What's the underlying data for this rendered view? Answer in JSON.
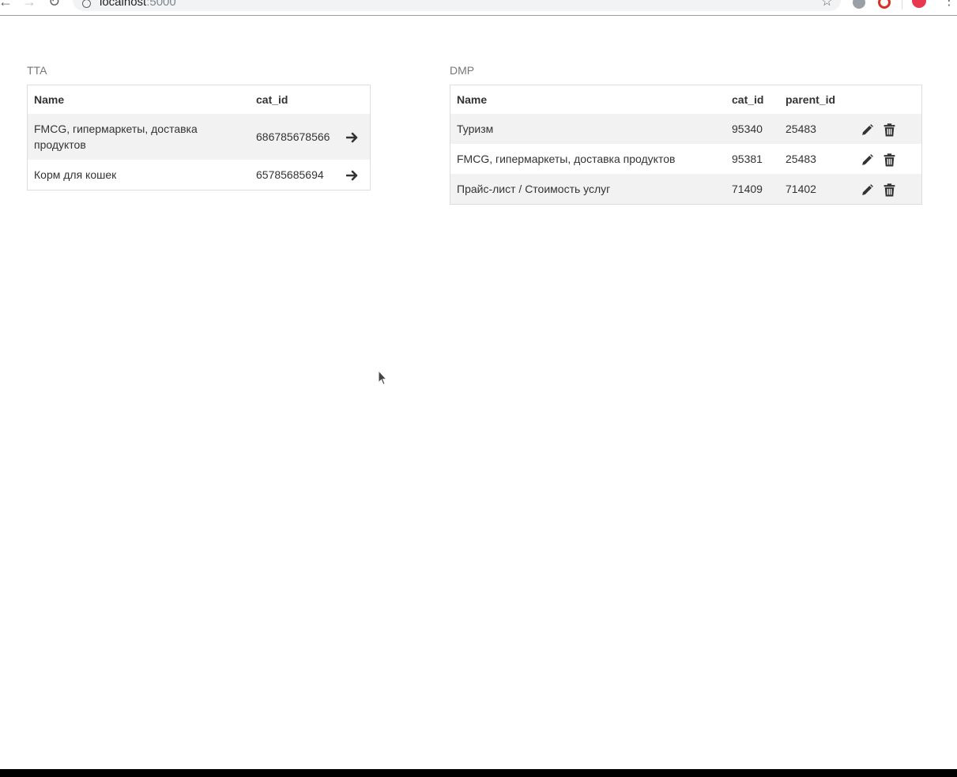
{
  "browser": {
    "url_host": "localhost",
    "url_port": ":5000"
  },
  "tta": {
    "heading": "TTA",
    "columns": [
      "Name",
      "cat_id"
    ],
    "rows": [
      {
        "name": "FMCG, гипермаркеты, доставка продуктов",
        "cat_id": "686785678566"
      },
      {
        "name": "Корм для кошек",
        "cat_id": "65785685694"
      }
    ],
    "row_action_icon": "arrow-right-icon"
  },
  "dmp": {
    "heading": "DMP",
    "columns": [
      "Name",
      "cat_id",
      "parent_id"
    ],
    "rows": [
      {
        "name": "Туризм",
        "cat_id": "95340",
        "parent_id": "25483"
      },
      {
        "name": "FMCG, гипермаркеты, доставка продуктов",
        "cat_id": "95381",
        "parent_id": "25483"
      },
      {
        "name": "Прайс-лист / Стоимость услуг",
        "cat_id": "71409",
        "parent_id": "71402"
      }
    ],
    "row_action_icons": [
      "pencil-icon",
      "trash-icon"
    ]
  },
  "colors": {
    "stripe": "#f2f2f2",
    "border": "#dddddd",
    "heading_text": "#777777",
    "body_text": "#333333"
  }
}
